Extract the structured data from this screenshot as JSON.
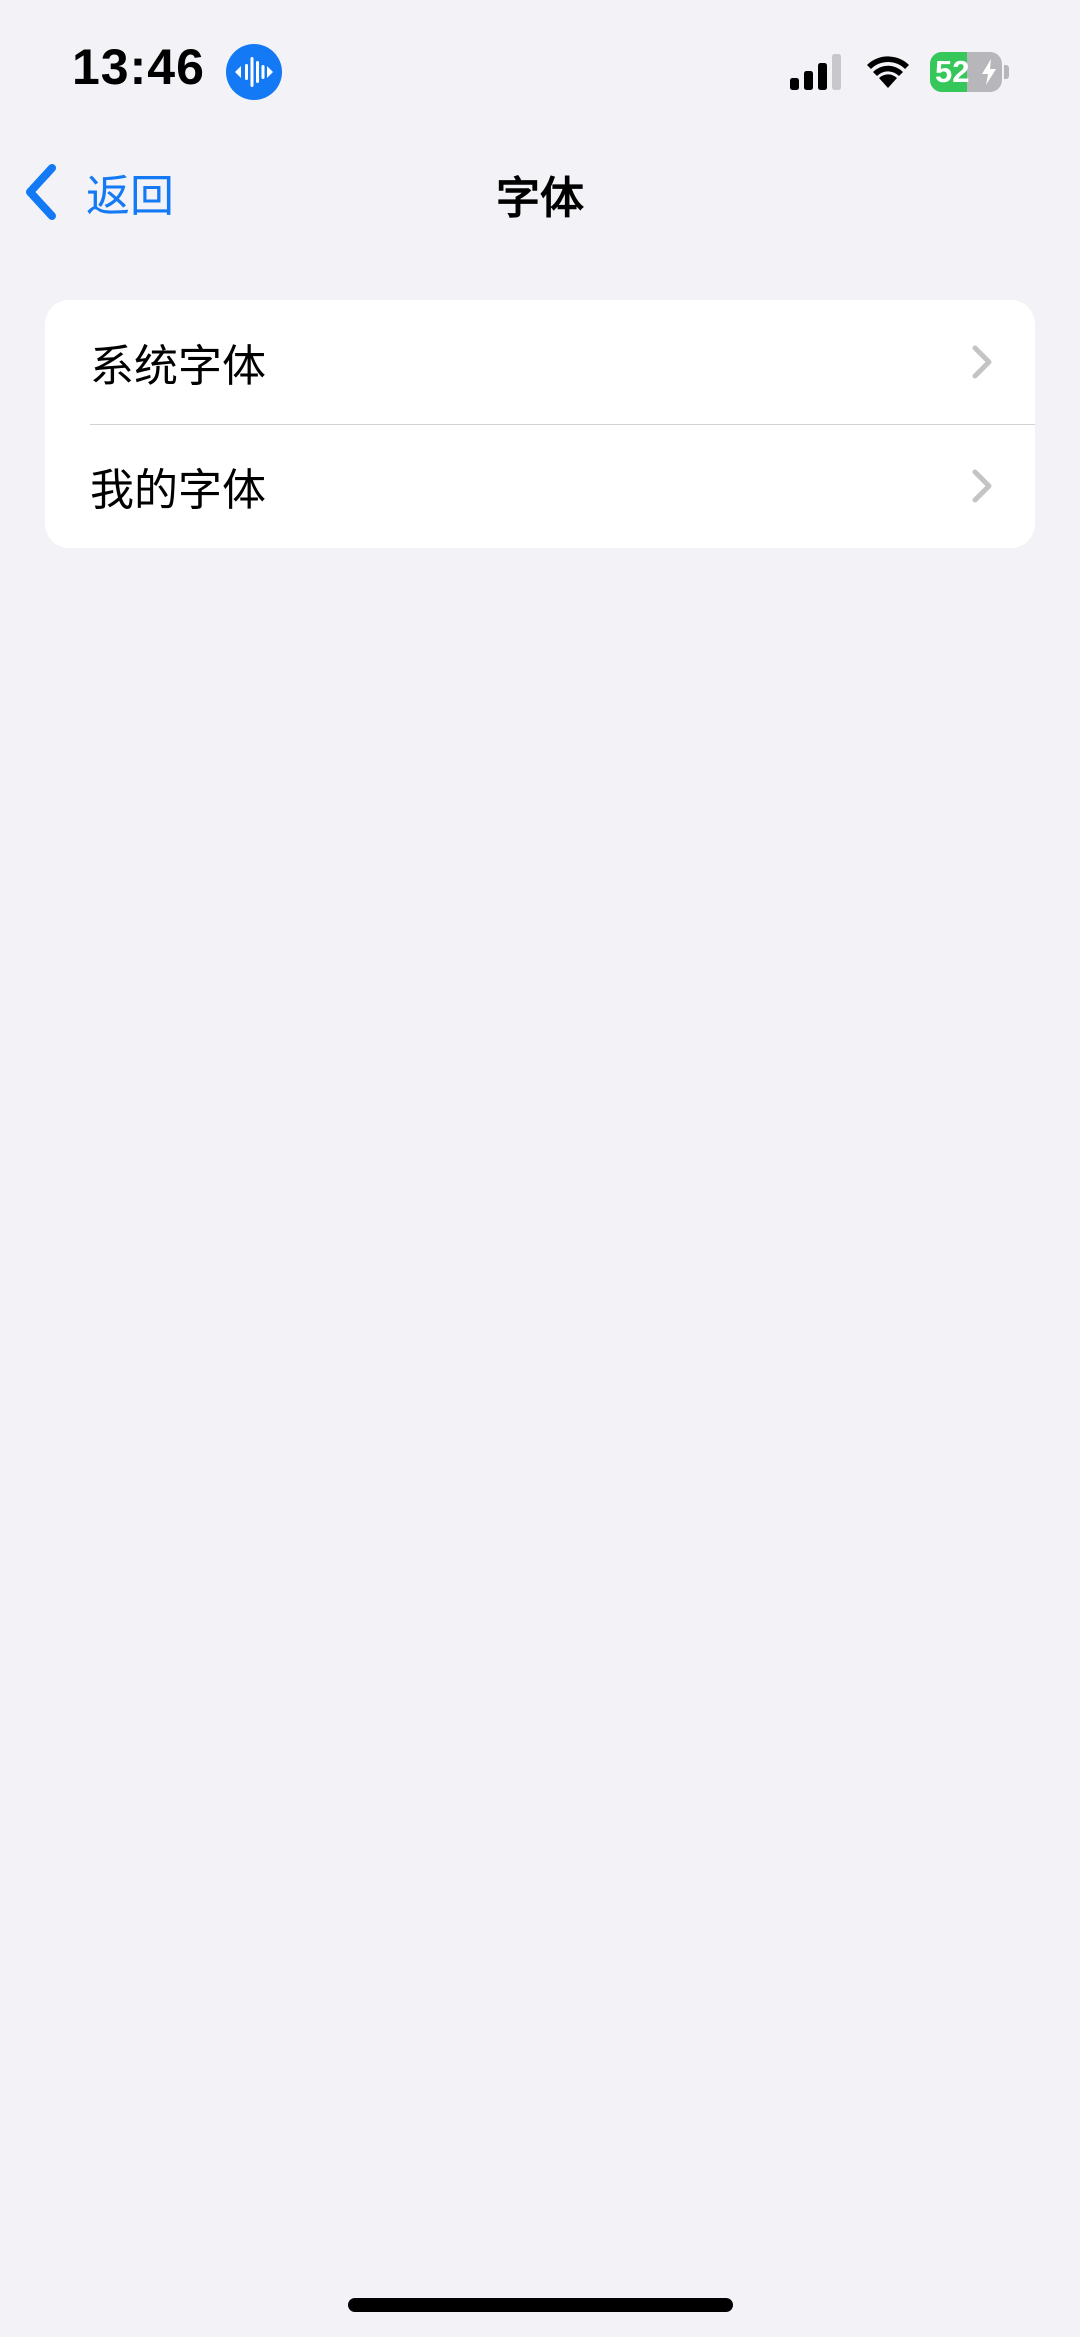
{
  "status_bar": {
    "time": "13:46",
    "battery_level": "52",
    "battery_percent": 52,
    "charging": true,
    "icons": [
      "sound-recognition-icon",
      "cellular-signal-icon",
      "wifi-icon",
      "battery-icon",
      "charging-bolt-icon"
    ]
  },
  "nav": {
    "back_label": "返回",
    "title": "字体"
  },
  "list": {
    "items": [
      {
        "label": "系统字体"
      },
      {
        "label": "我的字体"
      }
    ]
  },
  "colors": {
    "accent": "#1479F5",
    "background": "#F2F2F7",
    "card": "#FFFFFF",
    "battery_green": "#35C759",
    "chevron_gray": "#C4C4C7",
    "separator": "#D1D1D6"
  }
}
